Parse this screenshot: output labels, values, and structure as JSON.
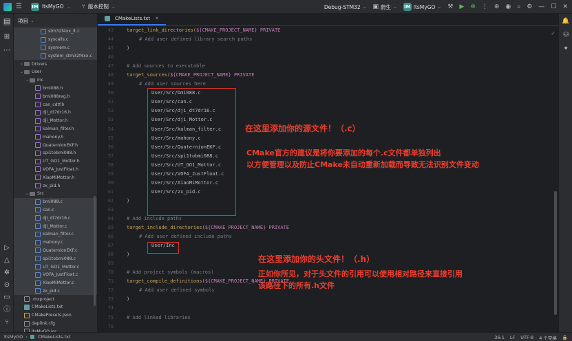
{
  "titlebar": {
    "project_badge": "IM",
    "project_name": "ltsMyGO",
    "vcs_label": "版本控制",
    "run_config": "Debug-STM32",
    "target_badge": "IM",
    "target_name": "ltsMyGO",
    "debugger_label": "蔚生"
  },
  "project_panel": {
    "title": "项目",
    "tree": [
      {
        "indent": 4,
        "arrow": "",
        "icon": "c",
        "label": "stm32f4xx_it.c",
        "sel": true
      },
      {
        "indent": 4,
        "arrow": "",
        "icon": "c",
        "label": "syscalls.c",
        "sel": true
      },
      {
        "indent": 4,
        "arrow": "",
        "icon": "c",
        "label": "sysmem.c",
        "sel": true
      },
      {
        "indent": 4,
        "arrow": "",
        "icon": "c",
        "label": "system_stm32f4xx.c",
        "sel": true
      },
      {
        "indent": 1,
        "arrow": "›",
        "icon": "folder",
        "label": "Drivers",
        "sel": false
      },
      {
        "indent": 1,
        "arrow": "⌄",
        "icon": "folder",
        "label": "User",
        "sel": false
      },
      {
        "indent": 2,
        "arrow": "⌄",
        "icon": "folder",
        "label": "Inc",
        "sel": false
      },
      {
        "indent": 3,
        "arrow": "",
        "icon": "h",
        "label": "bmi088.h",
        "sel": false
      },
      {
        "indent": 3,
        "arrow": "",
        "icon": "h",
        "label": "bmi088reg.h",
        "sel": false
      },
      {
        "indent": 3,
        "arrow": "",
        "icon": "h",
        "label": "can_cdtf.h",
        "sel": false
      },
      {
        "indent": 3,
        "arrow": "",
        "icon": "h",
        "label": "dji_dt7dr16.h",
        "sel": false
      },
      {
        "indent": 3,
        "arrow": "",
        "icon": "h",
        "label": "dji_Mottor.h",
        "sel": false
      },
      {
        "indent": 3,
        "arrow": "",
        "icon": "h",
        "label": "kalman_filter.h",
        "sel": false
      },
      {
        "indent": 3,
        "arrow": "",
        "icon": "h",
        "label": "mahony.h",
        "sel": false
      },
      {
        "indent": 3,
        "arrow": "",
        "icon": "h",
        "label": "QuaternionEKF.h",
        "sel": false
      },
      {
        "indent": 3,
        "arrow": "",
        "icon": "h",
        "label": "spi1tobmi088.h",
        "sel": false
      },
      {
        "indent": 3,
        "arrow": "",
        "icon": "h",
        "label": "UT_GO1_Mottor.h",
        "sel": false
      },
      {
        "indent": 3,
        "arrow": "",
        "icon": "h",
        "label": "VOFA_JustFloat.h",
        "sel": false
      },
      {
        "indent": 3,
        "arrow": "",
        "icon": "h",
        "label": "XiaoMiMottor.h",
        "sel": false
      },
      {
        "indent": 3,
        "arrow": "",
        "icon": "h",
        "label": "zx_pid.h",
        "sel": false
      },
      {
        "indent": 2,
        "arrow": "⌄",
        "icon": "folder",
        "label": "Src",
        "sel": false
      },
      {
        "indent": 3,
        "arrow": "",
        "icon": "c",
        "label": "bmi088.c",
        "sel": true
      },
      {
        "indent": 3,
        "arrow": "",
        "icon": "c",
        "label": "can.c",
        "sel": true
      },
      {
        "indent": 3,
        "arrow": "",
        "icon": "c",
        "label": "dji_dt7dr16.c",
        "sel": true
      },
      {
        "indent": 3,
        "arrow": "",
        "icon": "c",
        "label": "dji_Mottor.c",
        "sel": true
      },
      {
        "indent": 3,
        "arrow": "",
        "icon": "c",
        "label": "kalman_filter.c",
        "sel": true
      },
      {
        "indent": 3,
        "arrow": "",
        "icon": "c",
        "label": "mahony.c",
        "sel": true
      },
      {
        "indent": 3,
        "arrow": "",
        "icon": "c",
        "label": "QuaternionEKF.c",
        "sel": true
      },
      {
        "indent": 3,
        "arrow": "",
        "icon": "c",
        "label": "spi1tobmi088.c",
        "sel": true
      },
      {
        "indent": 3,
        "arrow": "",
        "icon": "c",
        "label": "UT_GO1_Mottor.c",
        "sel": true
      },
      {
        "indent": 3,
        "arrow": "",
        "icon": "c",
        "label": "VOFA_JustFloat.c",
        "sel": true
      },
      {
        "indent": 3,
        "arrow": "",
        "icon": "c",
        "label": "XiaoMiMottor.c",
        "sel": true
      },
      {
        "indent": 3,
        "arrow": "",
        "icon": "c",
        "label": "zx_pid.c",
        "sel": true
      },
      {
        "indent": 1,
        "arrow": "",
        "icon": "doc",
        "label": ".mxproject",
        "sel": false
      },
      {
        "indent": 1,
        "arrow": "",
        "icon": "cmake",
        "label": "CMakeLists.txt",
        "sel": false
      },
      {
        "indent": 1,
        "arrow": "",
        "icon": "json",
        "label": "CMakePresets.json",
        "sel": false
      },
      {
        "indent": 1,
        "arrow": "",
        "icon": "doc",
        "label": "daplink.cfg",
        "sel": false
      },
      {
        "indent": 1,
        "arrow": "",
        "icon": "doc",
        "label": "ltsMyGO.ioc",
        "sel": false
      }
    ]
  },
  "editor": {
    "tab_label": "CMakeLists.txt",
    "line_numbers": [
      "43",
      "44",
      "45",
      "46",
      "47",
      "48",
      "49",
      "50",
      "51",
      "52",
      "53",
      "54",
      "55",
      "56",
      "57",
      "58",
      "59",
      "60",
      "61",
      "62",
      "63",
      "64",
      "65",
      "66",
      "67",
      "68",
      "69",
      "70",
      "71",
      "72",
      "73",
      "74",
      "75",
      "76"
    ],
    "lines": [
      {
        "cls": "kw",
        "text": "target_link_directories(",
        "rest": "${CMAKE_PROJECT_NAME}",
        "tail": " PRIVATE",
        "ind": 0
      },
      {
        "cls": "cm",
        "text": "# Add user defined library search paths",
        "ind": 1
      },
      {
        "cls": "",
        "text": ")",
        "ind": 0
      },
      {
        "cls": "",
        "text": "",
        "ind": 0
      },
      {
        "cls": "cm",
        "text": "# Add sources to executable",
        "ind": 0
      },
      {
        "cls": "kw",
        "text": "target_sources(",
        "rest": "${CMAKE_PROJECT_NAME}",
        "tail": " PRIVATE",
        "ind": 0
      },
      {
        "cls": "cm",
        "text": "# Add user sources here",
        "ind": 1
      },
      {
        "cls": "",
        "text": "User/Src/bmi088.c",
        "ind": 2
      },
      {
        "cls": "",
        "text": "User/Src/can.c",
        "ind": 2
      },
      {
        "cls": "",
        "text": "User/Src/dji_dt7dr16.c",
        "ind": 2
      },
      {
        "cls": "",
        "text": "User/Src/dji_Mottor.c",
        "ind": 2
      },
      {
        "cls": "",
        "text": "User/Src/kalman_filter.c",
        "ind": 2
      },
      {
        "cls": "",
        "text": "User/Src/mahony.c",
        "ind": 2
      },
      {
        "cls": "",
        "text": "User/Src/QuaternionEKF.c",
        "ind": 2
      },
      {
        "cls": "",
        "text": "User/Src/spi1tobmi088.c",
        "ind": 2
      },
      {
        "cls": "",
        "text": "User/Src/UT_GO1_Mottor.c",
        "ind": 2
      },
      {
        "cls": "",
        "text": "User/Src/VOFA_JustFloat.c",
        "ind": 2
      },
      {
        "cls": "",
        "text": "User/Src/XiaoMiMottor.c",
        "ind": 2
      },
      {
        "cls": "",
        "text": "User/Src/zx_pid.c",
        "ind": 2
      },
      {
        "cls": "",
        "text": ")",
        "ind": 0
      },
      {
        "cls": "",
        "text": "",
        "ind": 0
      },
      {
        "cls": "cm",
        "text": "# Add include paths",
        "ind": 0
      },
      {
        "cls": "kw",
        "text": "target_include_directories(",
        "rest": "${CMAKE_PROJECT_NAME}",
        "tail": " PRIVATE",
        "ind": 0
      },
      {
        "cls": "cm",
        "text": "# Add user defined include paths",
        "ind": 1
      },
      {
        "cls": "",
        "text": "User/Inc",
        "ind": 2
      },
      {
        "cls": "",
        "text": ")",
        "ind": 0
      },
      {
        "cls": "",
        "text": "",
        "ind": 0
      },
      {
        "cls": "cm",
        "text": "# Add project symbols (macros)",
        "ind": 0
      },
      {
        "cls": "kw",
        "text": "target_compile_definitions(",
        "rest": "${CMAKE_PROJECT_NAME}",
        "tail": " PRIVATE",
        "ind": 0
      },
      {
        "cls": "cm",
        "text": "# Add user defined symbols",
        "ind": 1
      },
      {
        "cls": "",
        "text": ")",
        "ind": 0
      },
      {
        "cls": "",
        "text": "",
        "ind": 0
      },
      {
        "cls": "cm",
        "text": "# Add linked libraries",
        "ind": 0
      },
      {
        "cls": "",
        "text": "",
        "ind": 0
      }
    ]
  },
  "annotations": {
    "src_title": "在这里添加你的源文件！（.c）",
    "src_note1": "CMake官方的建议是将你要添加的每个.c文件都单独列出",
    "src_note2": "以方便管理以及防止CMake未自动重新加载而导致无法识别文件变动",
    "inc_title": "在这里添加你的头文件！（.h）",
    "inc_note1": "正如你所见，对于头文件的引用可以使用相对路径来直接引用",
    "inc_note2": "该路径下的所有.h文件"
  },
  "statusbar": {
    "crumb1": "ltsMyGO",
    "crumb2": "CMakeLists.txt",
    "position": "36:1",
    "line_sep": "LF",
    "encoding": "UTF-8",
    "indent": "4 个空格"
  },
  "colors": {
    "accent": "#3574f0",
    "annotation": "#ee3f2f",
    "box": "#e0302a"
  }
}
